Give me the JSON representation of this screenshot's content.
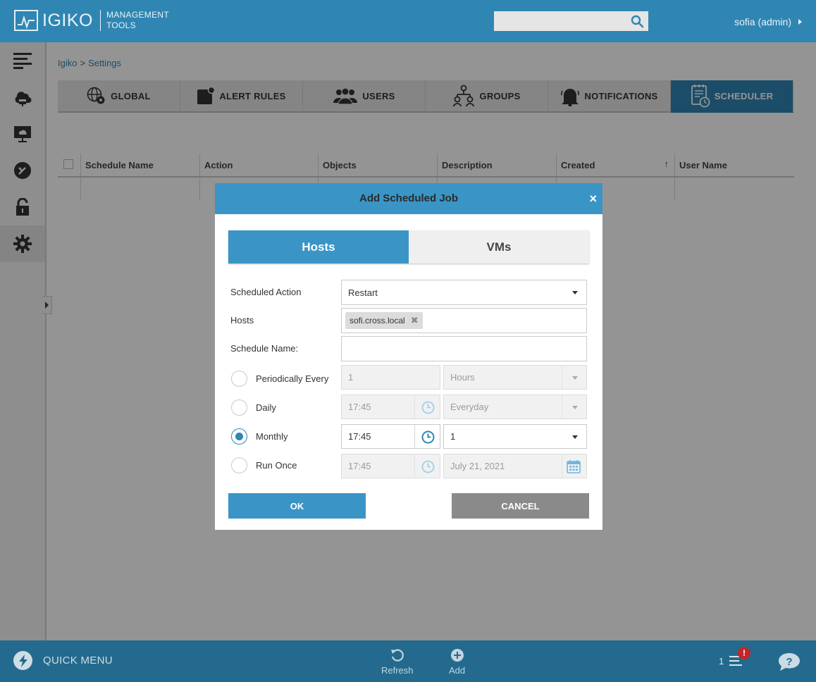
{
  "app": {
    "logo_name": "IGIKO",
    "logo_sub_line1": "MANAGEMENT",
    "logo_sub_line2": "TOOLS",
    "user": "sofia (admin)",
    "search_placeholder": ""
  },
  "breadcrumb": {
    "root": "Igiko",
    "sep": ">",
    "current": "Settings"
  },
  "tabs": [
    {
      "label": "GLOBAL",
      "icon": "globe-gear-icon",
      "active": false
    },
    {
      "label": "ALERT RULES",
      "icon": "alert-rules-icon",
      "active": false
    },
    {
      "label": "USERS",
      "icon": "users-icon",
      "active": false
    },
    {
      "label": "GROUPS",
      "icon": "groups-icon",
      "active": false
    },
    {
      "label": "NOTIFICATIONS",
      "icon": "bell-icon",
      "active": false
    },
    {
      "label": "SCHEDULER",
      "icon": "scheduler-icon",
      "active": true
    }
  ],
  "table": {
    "columns": [
      "Schedule Name",
      "Action",
      "Objects",
      "Description",
      "Created",
      "User Name"
    ],
    "sort_indicator": "↑"
  },
  "dialog": {
    "title": "Add Scheduled Job",
    "close": "×",
    "segments": {
      "hosts": "Hosts",
      "vms": "VMs",
      "active": "Hosts"
    },
    "scheduled_action": {
      "label": "Scheduled Action",
      "value": "Restart"
    },
    "hosts": {
      "label": "Hosts",
      "chip": "sofi.cross.local",
      "chip_remove": "✖"
    },
    "schedule_name": {
      "label": "Schedule Name:",
      "value": ""
    },
    "periodic": {
      "label": "Periodically Every",
      "value": "1",
      "unit": "Hours",
      "checked": false
    },
    "daily": {
      "label": "Daily",
      "time": "17:45",
      "option": "Everyday",
      "checked": false
    },
    "monthly": {
      "label": "Monthly",
      "time": "17:45",
      "day": "1",
      "checked": true
    },
    "run_once": {
      "label": "Run Once",
      "time": "17:45",
      "date": "July 21, 2021",
      "checked": false
    },
    "ok": "OK",
    "cancel": "CANCEL"
  },
  "bottom_bar": {
    "quick_menu": "QUICK MENU",
    "refresh": "Refresh",
    "add": "Add",
    "notif_count": "1",
    "alert_badge": "!"
  },
  "colors": {
    "primary": "#2f86b3",
    "dialog_header": "#3a95c6",
    "bottom_bar": "#236a8e",
    "badge": "#c0282a"
  }
}
